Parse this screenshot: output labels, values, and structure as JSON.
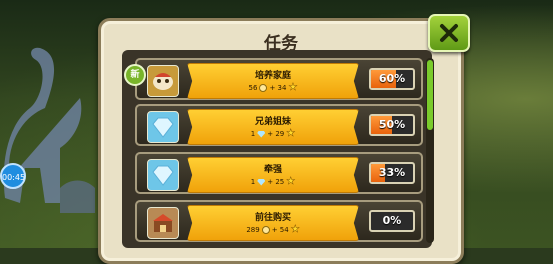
{
  "timer": "00:45",
  "dialog": {
    "title": "任务"
  },
  "new_badge": "新",
  "colors": {
    "banner": "#f6b51a",
    "progress_fill": "#f07a1a",
    "accent_green": "#7acb2b"
  },
  "quests": [
    {
      "name": "培养家庭",
      "coins": "56",
      "stars": "+ 34",
      "progress_label": "60%",
      "progress": 0.6,
      "icon": "mushroom-creature-icon",
      "reward_type": "coin"
    },
    {
      "name": "兄弟姐妹",
      "gems": "1",
      "stars": "+ 29",
      "progress_label": "50%",
      "progress": 0.5,
      "icon": "diamond-icon",
      "reward_type": "gem"
    },
    {
      "name": "牵强",
      "gems": "1",
      "stars": "+ 25",
      "progress_label": "33%",
      "progress": 0.33,
      "icon": "diamond-icon",
      "reward_type": "gem"
    },
    {
      "name": "前往购买",
      "coins": "289",
      "stars": "+ 54",
      "progress_label": "0%",
      "progress": 0.0,
      "icon": "shop-stall-icon",
      "reward_type": "coin"
    }
  ]
}
